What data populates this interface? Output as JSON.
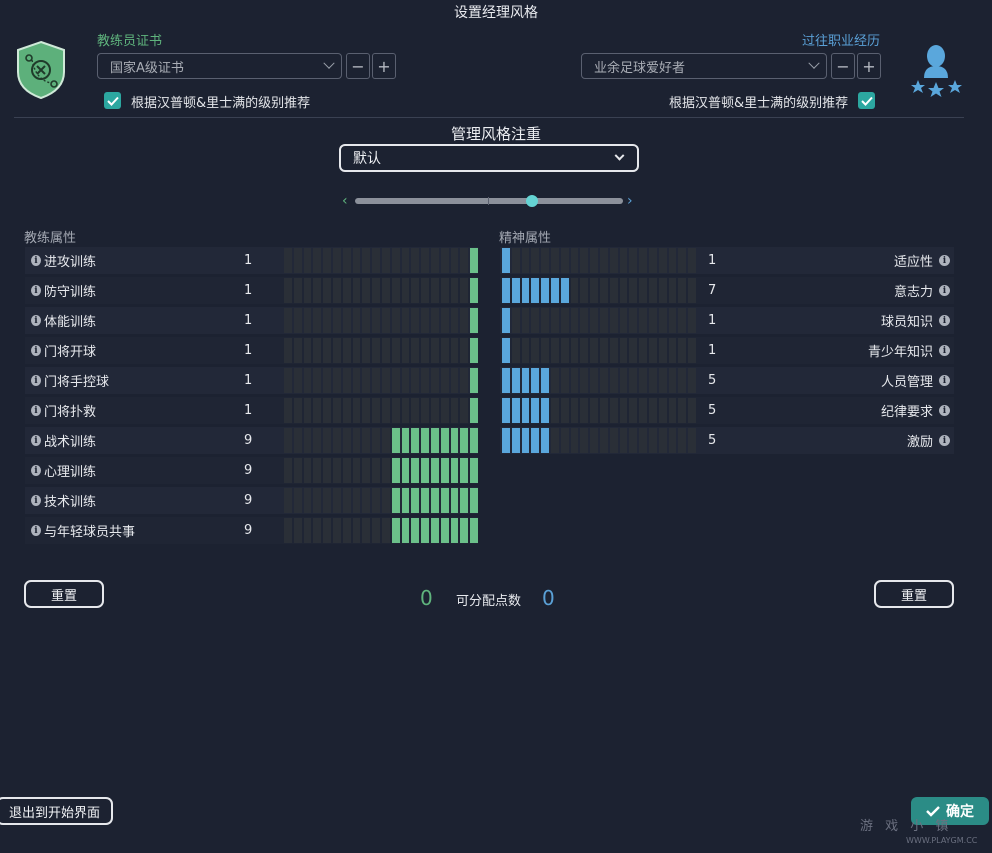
{
  "window": {
    "title": "设置经理风格"
  },
  "left_panel": {
    "label": "教练员证书",
    "dropdown_value": "国家A级证书",
    "checkbox_label": "根据汉普顿&里士满的级别推荐"
  },
  "right_panel": {
    "label": "过往职业经历",
    "dropdown_value": "业余足球爱好者",
    "checkbox_label": "根据汉普顿&里士满的级别推荐"
  },
  "stepper": {
    "minus": "−",
    "plus": "+"
  },
  "style": {
    "title": "管理风格注重",
    "selected": "默认",
    "slider_position": 0.66
  },
  "coaching": {
    "header": "教练属性",
    "max": 20,
    "color": "#6bc08a",
    "rows": [
      {
        "name": "进攻训练",
        "value": 1
      },
      {
        "name": "防守训练",
        "value": 1
      },
      {
        "name": "体能训练",
        "value": 1
      },
      {
        "name": "门将开球",
        "value": 1
      },
      {
        "name": "门将手控球",
        "value": 1
      },
      {
        "name": "门将扑救",
        "value": 1
      },
      {
        "name": "战术训练",
        "value": 9
      },
      {
        "name": "心理训练",
        "value": 9
      },
      {
        "name": "技术训练",
        "value": 9
      },
      {
        "name": "与年轻球员共事",
        "value": 9
      }
    ]
  },
  "mental": {
    "header": "精神属性",
    "max": 20,
    "color": "#5aa7dc",
    "rows": [
      {
        "name": "适应性",
        "value": 1
      },
      {
        "name": "意志力",
        "value": 7
      },
      {
        "name": "球员知识",
        "value": 1
      },
      {
        "name": "青少年知识",
        "value": 1
      },
      {
        "name": "人员管理",
        "value": 5
      },
      {
        "name": "纪律要求",
        "value": 5
      },
      {
        "name": "激励",
        "value": 5
      }
    ]
  },
  "points": {
    "label": "可分配点数",
    "left_value": "0",
    "right_value": "0"
  },
  "buttons": {
    "reset_left": "重置",
    "reset_right": "重置",
    "exit": "退出到开始界面",
    "confirm": "确定"
  },
  "info_glyph": "i",
  "watermark": {
    "text": "游 戏 小 镇",
    "url": "WWW.PLAYGM.CC"
  }
}
